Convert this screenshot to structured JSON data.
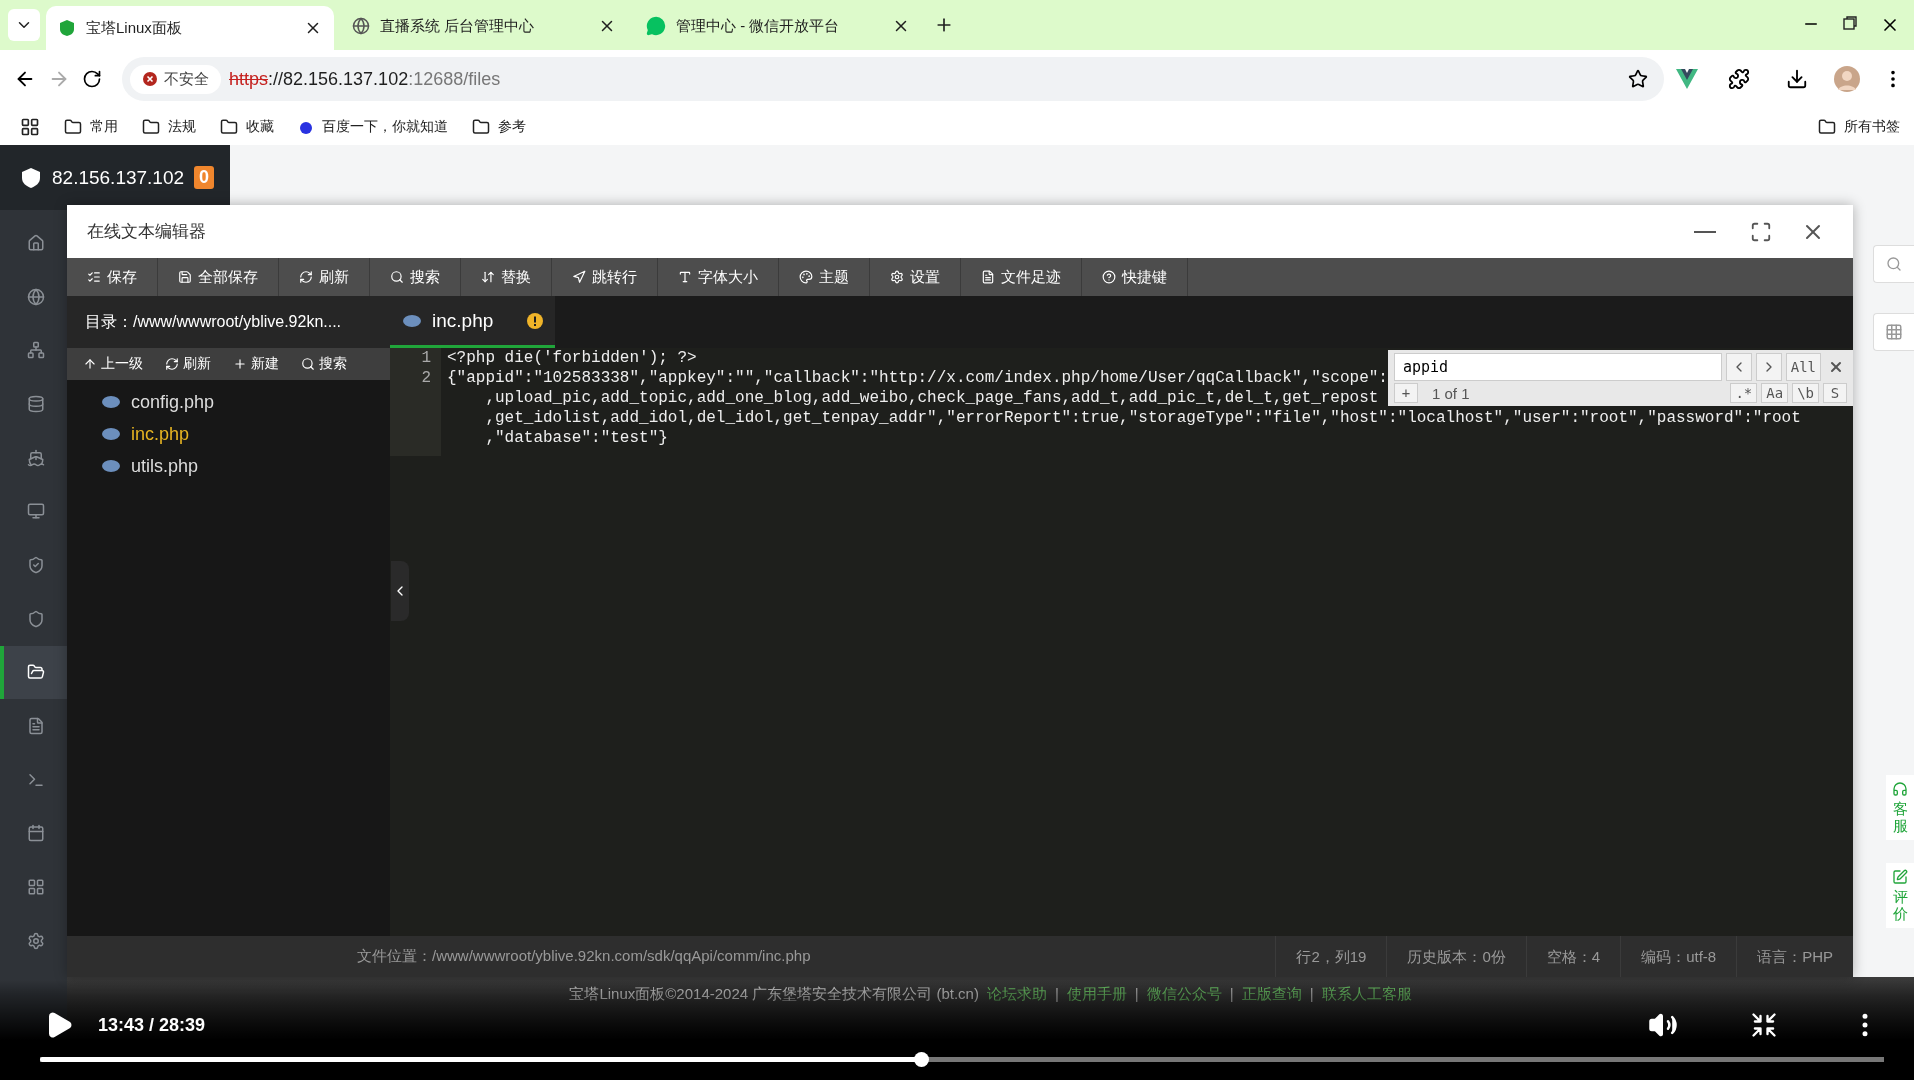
{
  "browser": {
    "tabs": [
      {
        "title": "宝塔Linux面板",
        "selected": true
      },
      {
        "title": "直播系统 后台管理中心",
        "selected": false
      },
      {
        "title": "管理中心 - 微信开放平台",
        "selected": false
      }
    ],
    "security": "不安全",
    "url": {
      "scheme": "https",
      "host": "://82.156.137.102",
      "rest": ":12688/files"
    },
    "bookmarks": [
      "常用",
      "法规",
      "收藏",
      "百度一下，你就知道",
      "参考"
    ],
    "all_bookmarks": "所有书签"
  },
  "panel": {
    "server": "82.156.137.102",
    "badge": "0",
    "sidebar": {
      "items": [
        {
          "selected": false
        },
        {
          "selected": false
        },
        {
          "selected": false
        },
        {
          "selected": false
        },
        {
          "selected": false
        },
        {
          "selected": false
        },
        {
          "selected": false
        },
        {
          "selected": false
        },
        {
          "selected": true
        },
        {
          "selected": false
        },
        {
          "selected": false
        },
        {
          "selected": false
        },
        {
          "selected": false
        },
        {
          "selected": false
        }
      ]
    },
    "footer": {
      "copyright": "宝塔Linux面板©2014-2024 广东堡塔安全技术有限公司 (bt.cn)",
      "links": [
        "论坛求助",
        "使用手册",
        "微信公众号",
        "正版查询",
        "联系人工客服"
      ],
      "separator": "|"
    },
    "float_buttons": [
      "客服",
      "评价"
    ]
  },
  "editor": {
    "title": "在线文本编辑器",
    "toolbar": [
      "保存",
      "全部保存",
      "刷新",
      "搜索",
      "替换",
      "跳转行",
      "字体大小",
      "主题",
      "设置",
      "文件足迹",
      "快捷键"
    ],
    "directory": "目录：/www/wwwroot/yblive.92kn....",
    "tree_actions": [
      "上一级",
      "刷新",
      "新建",
      "搜索"
    ],
    "files": [
      {
        "name": "config.php",
        "selected": false
      },
      {
        "name": "inc.php",
        "selected": true
      },
      {
        "name": "utils.php",
        "selected": false
      }
    ],
    "tab": {
      "name": "inc.php",
      "warning": true
    },
    "lines": [
      {
        "number": "1",
        "rows": [
          "<?php die('forbidden'); ?>"
        ]
      },
      {
        "number": "2",
        "rows": [
          "{\"appid\":\"102583338\",\"appkey\":\"\",\"callback\":\"http://x.com/index.php/home/User/qqCallback\",\"scope\":",
          "    ,upload_pic,add_topic,add_one_blog,add_weibo,check_page_fans,add_t,add_pic_t,del_t,get_repost",
          "    ,get_idolist,add_idol,del_idol,get_tenpay_addr\",\"errorReport\":true,\"storageType\":\"file\",\"host\":\"localhost\",\"user\":\"root\",\"password\":\"root",
          "    ,\"database\":\"test\"}"
        ]
      }
    ],
    "find": {
      "value": "appid",
      "all": "All",
      "plus": "+",
      "count": "1 of 1",
      "options": [
        ".*",
        "Aa",
        "\\b",
        "S"
      ]
    },
    "status": {
      "path": "文件位置：/www/wwwroot/yblive.92kn.com/sdk/qqApi/comm/inc.php",
      "items": [
        "行2，列19",
        "历史版本：0份",
        "空格：4",
        "编码：utf-8",
        "语言：PHP"
      ]
    }
  },
  "video": {
    "time": "13:43 / 28:39",
    "level": 0.478
  }
}
